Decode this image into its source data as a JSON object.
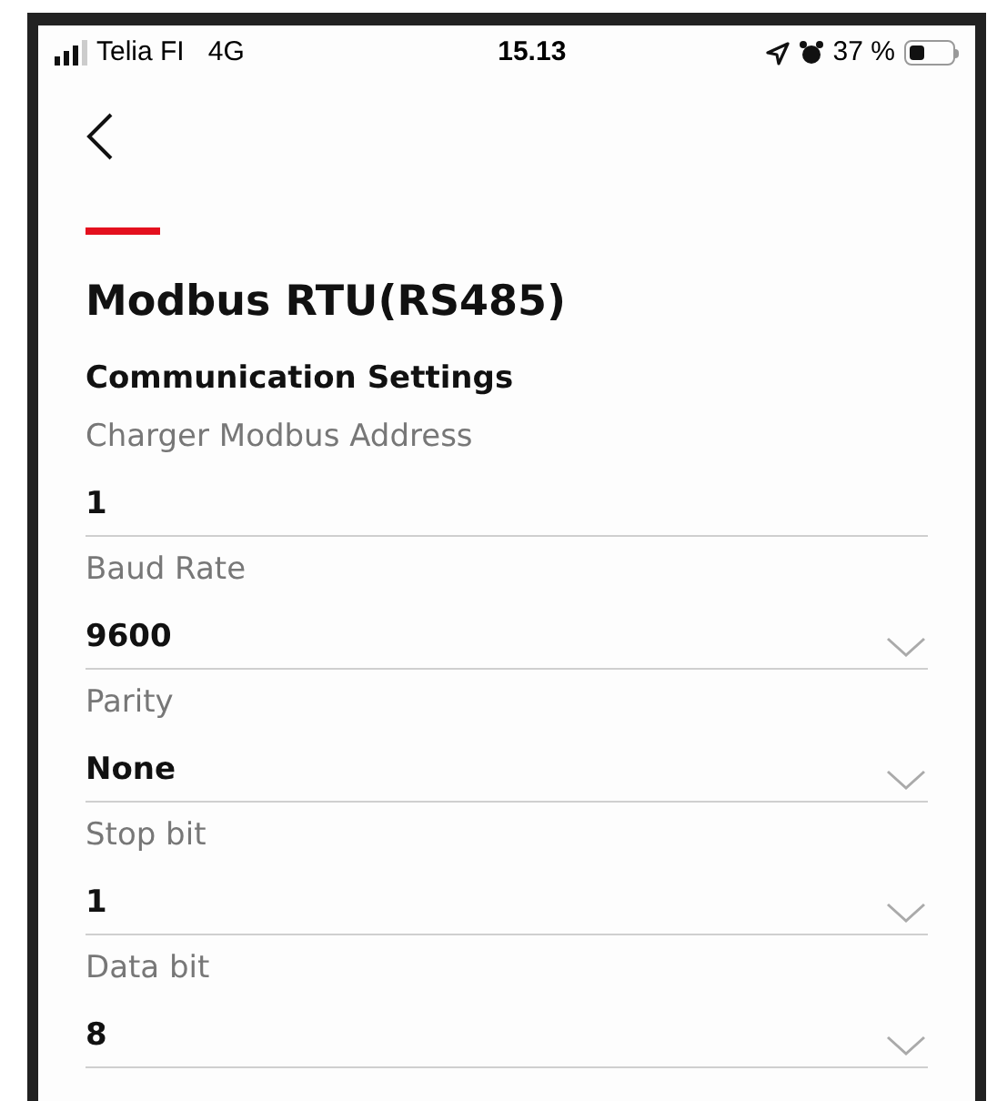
{
  "status_bar": {
    "carrier": "Telia FI",
    "network": "4G",
    "time": "15.13",
    "battery": "37 %"
  },
  "title": "Modbus RTU(RS485)",
  "section": "Communication Settings",
  "fields": [
    {
      "kind": "text",
      "label": "Charger Modbus Address",
      "value": "1"
    },
    {
      "kind": "dropdown",
      "label": "Baud Rate",
      "value": "9600"
    },
    {
      "kind": "dropdown",
      "label": "Parity",
      "value": "None"
    },
    {
      "kind": "dropdown",
      "label": "Stop bit",
      "value": "1"
    },
    {
      "kind": "dropdown",
      "label": "Data bit",
      "value": "8"
    }
  ]
}
